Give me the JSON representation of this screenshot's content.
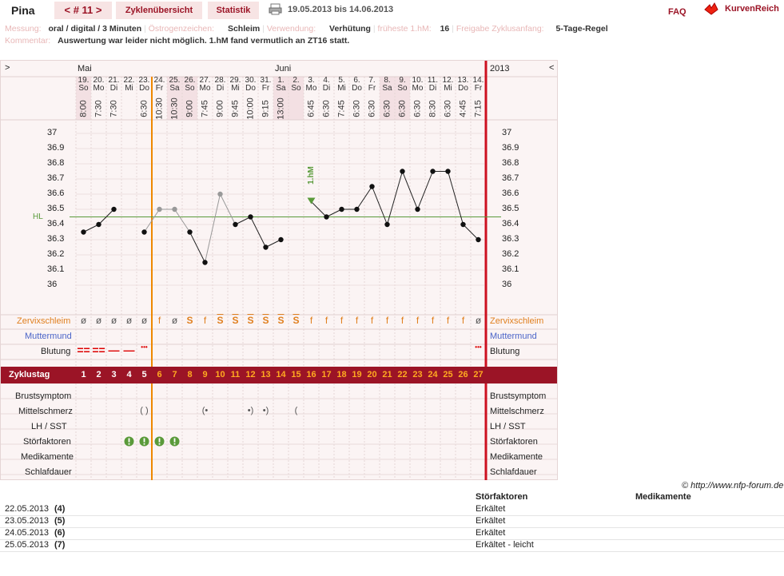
{
  "header": {
    "name": "Pina",
    "cycle": "< # 11 >",
    "tab_overview": "Zyklenübersicht",
    "tab_stats": "Statistik",
    "date_range": "19.05.2013 bis 14.06.2013",
    "faq": "FAQ",
    "logo": "KurvenReich"
  },
  "info": {
    "messung_label": "Messung:",
    "messung": "oral / digital / 3 Minuten",
    "oestrogen_label": "Östrogenzeichen:",
    "oestrogen": "Schleim",
    "verwendung_label": "Verwendung:",
    "verwendung": "Verhütung",
    "hm_label": "früheste 1.hM:",
    "hm": "16",
    "freigabe_label": "Freigabe Zyklusanfang:",
    "freigabe": "5-Tage-Regel",
    "kommentar_label": "Kommentar:",
    "kommentar": "Auswertung war leider nicht möglich. 1.hM fand vermutlich an ZT16 statt."
  },
  "chart_data": {
    "type": "line",
    "title": "",
    "xlabel": "",
    "ylabel": "",
    "ylim": [
      36.0,
      37.0
    ],
    "y_ticks": [
      "37",
      "36.9",
      "36.8",
      "36.7",
      "36.6",
      "36.5",
      "36.4",
      "36.3",
      "36.2",
      "36.1",
      "36"
    ],
    "hl_label": "HL",
    "hl_value": 36.45,
    "hm_label": "1.hM",
    "months": {
      "left": "Mai",
      "mid": "Juni",
      "year": "2013",
      "nav_left": ">",
      "nav_right": "<"
    },
    "days": [
      {
        "d": "19.",
        "wd": "So",
        "t": "8:00",
        "we": true,
        "temp": 36.35,
        "zs": "ø",
        "blut": "2",
        "cd": "1"
      },
      {
        "d": "20.",
        "wd": "Mo",
        "t": "7:30",
        "we": false,
        "temp": 36.4,
        "zs": "ø",
        "blut": "2",
        "cd": "2"
      },
      {
        "d": "21.",
        "wd": "Di",
        "t": "7:30",
        "we": false,
        "temp": 36.5,
        "zs": "ø",
        "blut": "1",
        "cd": "3"
      },
      {
        "d": "22.",
        "wd": "Mi",
        "t": "",
        "we": false,
        "temp": null,
        "zs": "ø",
        "blut": "1",
        "cd": "4"
      },
      {
        "d": "23.",
        "wd": "Do",
        "t": "6:30",
        "we": false,
        "temp": 36.35,
        "zs": "ø",
        "blut": "s",
        "cd": "5"
      },
      {
        "d": "24.",
        "wd": "Fr",
        "t": "10:30",
        "we": false,
        "temp": 36.5,
        "zs": "f",
        "blut": "",
        "cd": "6",
        "grey": true
      },
      {
        "d": "25.",
        "wd": "Sa",
        "t": "10:30",
        "we": true,
        "temp": 36.5,
        "zs": "ø",
        "blut": "",
        "cd": "7",
        "grey": true
      },
      {
        "d": "26.",
        "wd": "So",
        "t": "9:00",
        "we": true,
        "temp": 36.35,
        "zs": "S",
        "blut": "",
        "cd": "8"
      },
      {
        "d": "27.",
        "wd": "Mo",
        "t": "7:45",
        "we": false,
        "temp": 36.15,
        "zs": "f",
        "blut": "",
        "cd": "9"
      },
      {
        "d": "28.",
        "wd": "Di",
        "t": "9:00",
        "we": false,
        "temp": 36.6,
        "zs": "S+",
        "blut": "",
        "cd": "10",
        "grey": true
      },
      {
        "d": "29.",
        "wd": "Mi",
        "t": "9:45",
        "we": false,
        "temp": 36.4,
        "zs": "S+",
        "blut": "",
        "cd": "11"
      },
      {
        "d": "30.",
        "wd": "Do",
        "t": "10:00",
        "we": false,
        "temp": 36.45,
        "zs": "S+",
        "blut": "",
        "cd": "12"
      },
      {
        "d": "31.",
        "wd": "Fr",
        "t": "9:15",
        "we": false,
        "temp": 36.25,
        "zs": "S+",
        "blut": "",
        "cd": "13"
      },
      {
        "d": "1.",
        "wd": "Sa",
        "t": "13:00",
        "we": true,
        "temp": 36.3,
        "zs": "S+",
        "blut": "",
        "cd": "14"
      },
      {
        "d": "2.",
        "wd": "So",
        "t": "",
        "we": true,
        "temp": null,
        "zs": "S+",
        "blut": "",
        "cd": "15"
      },
      {
        "d": "3.",
        "wd": "Mo",
        "t": "6:45",
        "we": false,
        "temp": 36.55,
        "zs": "f",
        "blut": "",
        "cd": "16",
        "hm": true
      },
      {
        "d": "4.",
        "wd": "Di",
        "t": "6:30",
        "we": false,
        "temp": 36.45,
        "zs": "f",
        "blut": "",
        "cd": "17"
      },
      {
        "d": "5.",
        "wd": "Mi",
        "t": "7:45",
        "we": false,
        "temp": 36.5,
        "zs": "f",
        "blut": "",
        "cd": "18"
      },
      {
        "d": "6.",
        "wd": "Do",
        "t": "6:30",
        "we": false,
        "temp": 36.5,
        "zs": "f",
        "blut": "",
        "cd": "19"
      },
      {
        "d": "7.",
        "wd": "Fr",
        "t": "6:30",
        "we": false,
        "temp": 36.65,
        "zs": "f",
        "blut": "",
        "cd": "20"
      },
      {
        "d": "8.",
        "wd": "Sa",
        "t": "6:30",
        "we": true,
        "temp": 36.4,
        "zs": "f",
        "blut": "",
        "cd": "21"
      },
      {
        "d": "9.",
        "wd": "So",
        "t": "6:30",
        "we": true,
        "temp": 36.75,
        "zs": "f",
        "blut": "",
        "cd": "22"
      },
      {
        "d": "10.",
        "wd": "Mo",
        "t": "6:30",
        "we": false,
        "temp": 36.5,
        "zs": "f",
        "blut": "",
        "cd": "23"
      },
      {
        "d": "11.",
        "wd": "Di",
        "t": "8:30",
        "we": false,
        "temp": 36.75,
        "zs": "f",
        "blut": "",
        "cd": "24"
      },
      {
        "d": "12.",
        "wd": "Mi",
        "t": "6:30",
        "we": false,
        "temp": 36.75,
        "zs": "f",
        "blut": "",
        "cd": "25"
      },
      {
        "d": "13.",
        "wd": "Do",
        "t": "4:45",
        "we": false,
        "temp": 36.4,
        "zs": "f",
        "blut": "",
        "cd": "26"
      },
      {
        "d": "14.",
        "wd": "Fr",
        "t": "7:15",
        "we": false,
        "temp": 36.3,
        "zs": "ø",
        "blut": "s",
        "cd": "27"
      }
    ]
  },
  "rows": {
    "zervix": "Zervixschleim",
    "mutter": "Muttermund",
    "blutung": "Blutung",
    "zyklustag": "Zyklustag",
    "brust": "Brustsymptom",
    "mittel": "Mittelschmerz",
    "lh": "LH / SST",
    "stoer": "Störfaktoren",
    "medi": "Medikamente",
    "schlaf": "Schlafdauer"
  },
  "mittelschmerz": [
    {
      "i": 4,
      "s": "( )"
    },
    {
      "i": 8,
      "s": "(•"
    },
    {
      "i": 11,
      "s": "•)"
    },
    {
      "i": 12,
      "s": "•)"
    },
    {
      "i": 14,
      "s": "("
    }
  ],
  "stoer_days": [
    3,
    4,
    5,
    6
  ],
  "footer": {
    "copyright": "© http://www.nfp-forum.de",
    "col_stoer": "Störfaktoren",
    "col_medi": "Medikamente",
    "rows": [
      {
        "date": "22.05.2013",
        "cd": "(4)",
        "stoer": "Erkältet"
      },
      {
        "date": "23.05.2013",
        "cd": "(5)",
        "stoer": "Erkältet"
      },
      {
        "date": "24.05.2013",
        "cd": "(6)",
        "stoer": "Erkältet"
      },
      {
        "date": "25.05.2013",
        "cd": "(7)",
        "stoer": "Erkältet - leicht"
      }
    ]
  },
  "colors": {
    "accent": "#9b1426",
    "orange": "#ee8800",
    "coverline": "#5a9a3a",
    "blue": "#4a64c8"
  }
}
